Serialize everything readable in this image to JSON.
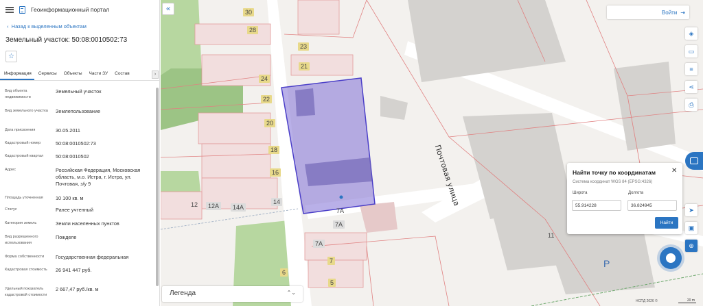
{
  "header": {
    "app_title": "Геоинформационный портал",
    "menu_icon": "menu-icon",
    "logo_icon": "document-icon"
  },
  "panel": {
    "back_link": "Назад к выделенным объектам",
    "object_title": "Земельный участок: 50:08:0010502:73",
    "favorite_icon": "star-icon",
    "tabs": [
      {
        "label": "Информация"
      },
      {
        "label": "Сервисы"
      },
      {
        "label": "Объекты"
      },
      {
        "label": "Части ЗУ"
      },
      {
        "label": "Состав"
      }
    ],
    "attributes": [
      {
        "key": "Вид объекта недвижимости",
        "value": "Земельный участок"
      },
      {
        "key": "Вид земельного участка",
        "value": "Землепользование"
      },
      {
        "key": "Дата присвоения",
        "value": "30.05.2011"
      },
      {
        "key": "Кадастровый номер",
        "value": "50:08:0010502:73"
      },
      {
        "key": "Кадастровый квартал",
        "value": "50:08:0010502"
      },
      {
        "key": "Адрес",
        "value": "Российская Федерация, Московская область, м.о. Истра, г. Истра, ул. Почтовая, з/у 9"
      },
      {
        "key": "Площадь уточненная",
        "value": "10 100 кв. м"
      },
      {
        "key": "Статус",
        "value": "Ранее учтенный"
      },
      {
        "key": "Категория земель",
        "value": "Земли населенных пунктов"
      },
      {
        "key": "Вид разрешенного использования",
        "value": "Пожделе"
      },
      {
        "key": "Форма собственности",
        "value": "Государственная федеральная"
      },
      {
        "key": "Кадастровая стоимость",
        "value": "26 941 447 руб."
      },
      {
        "key": "Удельный показатель кадастровой стоимости",
        "value": "2 667,47 руб./кв. м"
      }
    ]
  },
  "map": {
    "street_label": "Почтовая улица",
    "house_numbers": [
      "30",
      "28",
      "23",
      "21",
      "24",
      "22",
      "20",
      "18",
      "16",
      "14",
      "12",
      "12А",
      "14А",
      "7А",
      "7А",
      "7А",
      "7",
      "6",
      "5",
      "11",
      "Р"
    ],
    "collapse_icon": "double-chevron-left-icon",
    "login_label": "Войти",
    "login_icon": "login-icon",
    "tools": [
      "layers-icon",
      "basemap-icon",
      "settings-icon",
      "share-icon",
      "print-icon",
      "navigate-icon",
      "ruler-icon",
      "zoom-icon"
    ],
    "legend_label": "Легенда",
    "attribution": "НСПД 2026 ©",
    "scale": "20 m",
    "parcel_color": "#8b7bd8"
  },
  "coord_search": {
    "title": "Найти точку по координатам",
    "system": "Система координат WGS 84 (EPSG:4326)",
    "lat_label": "Широта",
    "lon_label": "Долгота",
    "lat_value": "55.914228",
    "lon_value": "36.824945",
    "find_button": "Найти"
  }
}
